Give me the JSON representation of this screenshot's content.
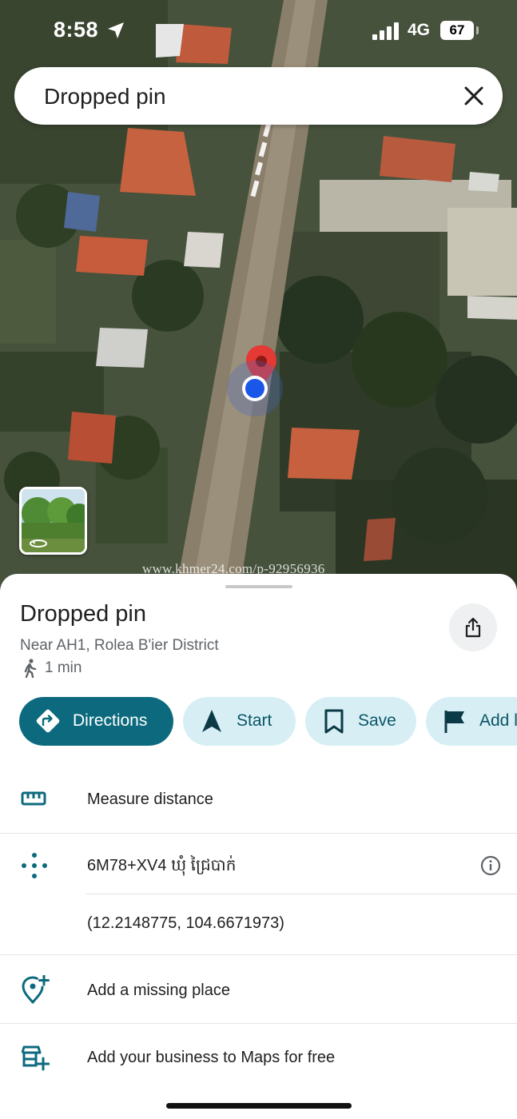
{
  "status_bar": {
    "time": "8:58",
    "network": "4G",
    "battery": "67",
    "location_icon": "location-arrow-icon",
    "signal_icon": "signal-bars-icon"
  },
  "search": {
    "text": "Dropped pin",
    "close_icon": "close-icon"
  },
  "map": {
    "watermark": "www.khmer24.com/p-92956936",
    "pin_icon": "red-pin-icon",
    "location_dot_icon": "blue-location-dot-icon",
    "street_view_icon": "street-view-rotate-icon"
  },
  "place": {
    "title": "Dropped pin",
    "subtitle": "Near AH1, Rolea B'ier District",
    "walk_time": "1 min",
    "walk_icon": "walking-person-icon",
    "share_icon": "share-icon"
  },
  "actions": [
    {
      "label": "Directions",
      "icon": "directions-icon"
    },
    {
      "label": "Start",
      "icon": "navigation-arrow-icon"
    },
    {
      "label": "Save",
      "icon": "bookmark-icon"
    },
    {
      "label": "Add l",
      "icon": "flag-icon"
    }
  ],
  "rows": {
    "measure": {
      "label": "Measure distance",
      "icon": "ruler-icon"
    },
    "plus_code": {
      "label": "6M78+XV4 ឃុំ ជ្រៃបាក់",
      "icon": "plus-code-icon",
      "info_icon": "info-icon"
    },
    "coordinates": {
      "label": "(12.2148775, 104.6671973)"
    },
    "missing_place": {
      "label": "Add a missing place",
      "icon": "add-location-icon"
    },
    "business": {
      "label": "Add your business to Maps for free",
      "icon": "add-business-icon"
    }
  },
  "colors": {
    "accent": "#0d6a7e",
    "chip_bg": "#d7eff4",
    "chip_text": "#0b5567",
    "pin_red": "#e53935",
    "location_blue": "#1a56e8"
  }
}
